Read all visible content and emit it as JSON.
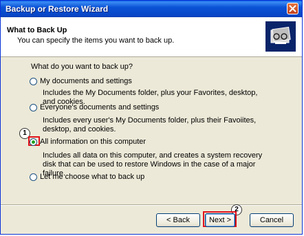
{
  "window": {
    "title": "Backup or Restore Wizard"
  },
  "header": {
    "title": "What to Back Up",
    "subtitle": "You can specify the items you want to back up."
  },
  "question": "What do you want to back up?",
  "options": [
    {
      "label": "My documents and settings",
      "description": "Includes the My Documents folder, plus your Favorites, desktop, and cookies.",
      "selected": false
    },
    {
      "label": "Everyone's documents and settings",
      "description": "Includes every user's My Documents folder, plus their Favoiites, desktop, and cookies.",
      "selected": false
    },
    {
      "label": "All information on this computer",
      "description": "Includes all data on this computer, and creates a system recovery disk that can be used to restore Windows in the case of a major failure.",
      "selected": true
    },
    {
      "label": "Let me choose what to back up",
      "description": "",
      "selected": false
    }
  ],
  "callouts": {
    "first": "1",
    "second": "2"
  },
  "buttons": {
    "back": "< Back",
    "next": "Next >",
    "cancel": "Cancel"
  },
  "colors": {
    "titlebar": "#0a52d6",
    "highlight": "#e0121b",
    "radio_dot": "#21a121"
  },
  "icons": {
    "close": "close-icon",
    "header": "backup-wizard-icon"
  }
}
